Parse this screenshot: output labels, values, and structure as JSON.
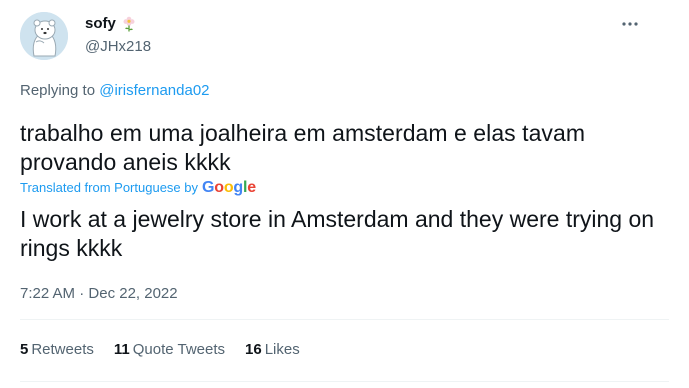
{
  "user": {
    "display_name": "sofy",
    "name_emoji": "flower-emoji",
    "handle": "@JHx218",
    "avatar": "polar-bear-avatar"
  },
  "menu_icon": "more-dots-icon",
  "reply": {
    "prefix": "Replying to",
    "mention": "@irisfernanda02"
  },
  "tweet": {
    "original_text": "trabalho em uma joalheira em amsterdam e elas tavam provando aneis kkkk",
    "translation_label": "Translated from Portuguese by",
    "translation_provider": "Google",
    "translated_text": "I work at a jewelry store in Amsterdam and they were trying on rings kkkk",
    "time": "7:22 AM",
    "separator": "·",
    "date": "Dec 22, 2022"
  },
  "stats": {
    "retweets_count": "5",
    "retweets_label": "Retweets",
    "quotes_count": "11",
    "quotes_label": "Quote Tweets",
    "likes_count": "16",
    "likes_label": "Likes"
  },
  "colors": {
    "accent": "#1d9bf0",
    "secondary_text": "#536471",
    "primary_text": "#0f1419",
    "divider": "#eff3f4"
  }
}
